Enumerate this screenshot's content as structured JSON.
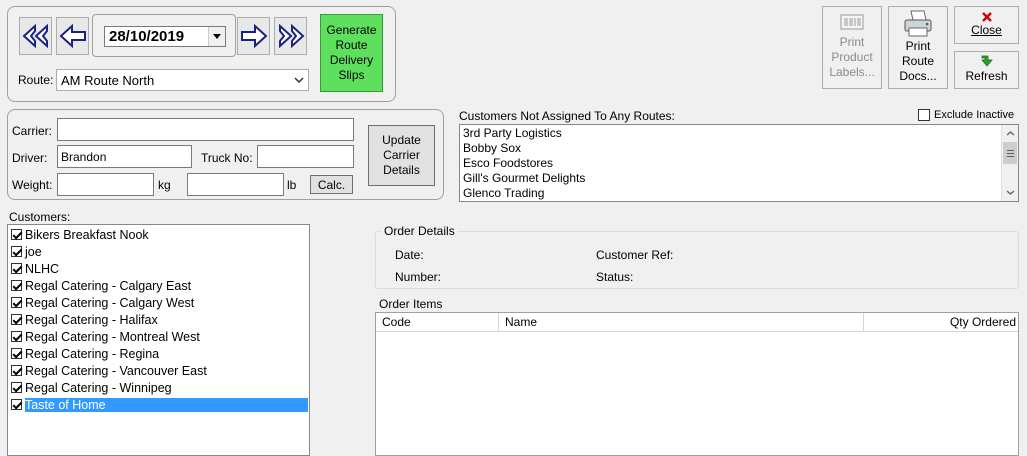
{
  "nav": {
    "date_value": "28/10/2019",
    "generate_label": "Generate Route Delivery Slips",
    "route_label": "Route:",
    "route_value": "AM Route North"
  },
  "carrier": {
    "carrier_label": "Carrier:",
    "carrier_value": "",
    "driver_label": "Driver:",
    "driver_value": "Brandon",
    "truck_label": "Truck No:",
    "truck_value": "",
    "weight_label": "Weight:",
    "weight_kg_value": "",
    "kg_unit": "kg",
    "weight_lb_value": "",
    "lb_unit": "lb",
    "calc_label": "Calc.",
    "update_label": "Update Carrier Details"
  },
  "unassigned": {
    "title": "Customers Not Assigned To Any Routes:",
    "exclude_inactive_label": "Exclude Inactive",
    "exclude_inactive_checked": false,
    "items": [
      "3rd Party Logistics",
      "Bobby Sox",
      "Esco Foodstores",
      "Gill's Gourmet Delights",
      "Glenco Trading"
    ]
  },
  "toolbar": {
    "print_labels": "Print Product Labels...",
    "print_route": "Print Route Docs...",
    "close": "Close",
    "refresh": "Refresh"
  },
  "customers": {
    "title": "Customers:",
    "items": [
      {
        "name": "Bikers Breakfast Nook",
        "checked": true
      },
      {
        "name": "joe",
        "checked": true
      },
      {
        "name": "NLHC",
        "checked": true
      },
      {
        "name": "Regal Catering - Calgary East",
        "checked": true
      },
      {
        "name": "Regal Catering - Calgary West",
        "checked": true
      },
      {
        "name": "Regal Catering - Halifax",
        "checked": true
      },
      {
        "name": "Regal Catering - Montreal West",
        "checked": true
      },
      {
        "name": "Regal Catering - Regina",
        "checked": true
      },
      {
        "name": "Regal Catering - Vancouver East",
        "checked": true
      },
      {
        "name": "Regal Catering - Winnipeg",
        "checked": true
      },
      {
        "name": "Taste of Home",
        "checked": true,
        "selected": true
      }
    ]
  },
  "order_details": {
    "title": "Order Details",
    "date_label": "Date:",
    "number_label": "Number:",
    "customer_ref_label": "Customer Ref:",
    "status_label": "Status:"
  },
  "order_items": {
    "title": "Order Items",
    "columns": [
      "Code",
      "Name",
      "Qty Ordered"
    ]
  },
  "colors": {
    "generate_bg": "#5ee05e",
    "selection": "#3399ff",
    "close_x": "#cc0000",
    "refresh_arrow": "#2e9e2e"
  }
}
